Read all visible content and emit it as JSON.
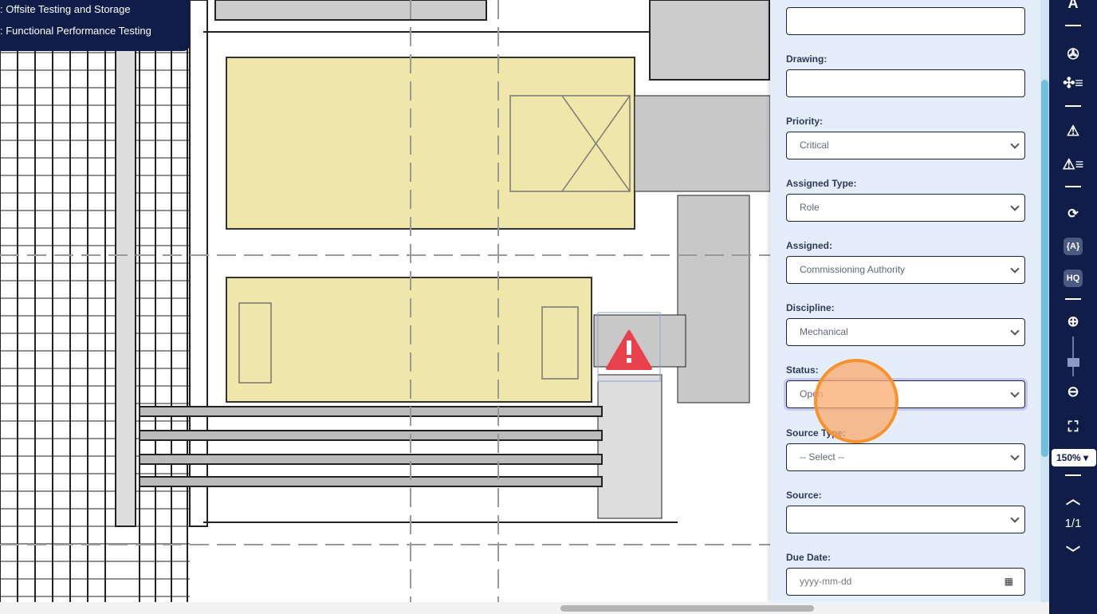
{
  "legend": {
    "items": [
      ": Offsite Testing and Storage",
      ": Functional Performance Testing"
    ]
  },
  "form": {
    "fields": [
      {
        "label": "",
        "value": "",
        "type": "text"
      },
      {
        "label": "Drawing:",
        "value": "",
        "type": "text"
      },
      {
        "label": "Priority:",
        "value": "Critical",
        "type": "select"
      },
      {
        "label": "Assigned Type:",
        "value": "Role",
        "type": "select"
      },
      {
        "label": "Assigned:",
        "value": "Commissioning Authority",
        "type": "select"
      },
      {
        "label": "Discipline:",
        "value": "Mechanical",
        "type": "select"
      },
      {
        "label": "Status:",
        "value": "Open",
        "type": "select"
      },
      {
        "label": "Source Type:",
        "value": "-- Select --",
        "type": "select"
      },
      {
        "label": "Source:",
        "value": "",
        "type": "select"
      },
      {
        "label": "Due Date:",
        "placeholder": "yyyy-mm-dd",
        "type": "date"
      }
    ]
  },
  "toolbar": {
    "zoom": "150%",
    "page": "1/1",
    "text_tool": "A",
    "badge_a": "{A}",
    "badge_hq": "HQ"
  },
  "colors": {
    "navy": "#0f1d48",
    "highlight": "#efe6a9",
    "warning": "#e8414b",
    "cursor": "#f7932f"
  }
}
